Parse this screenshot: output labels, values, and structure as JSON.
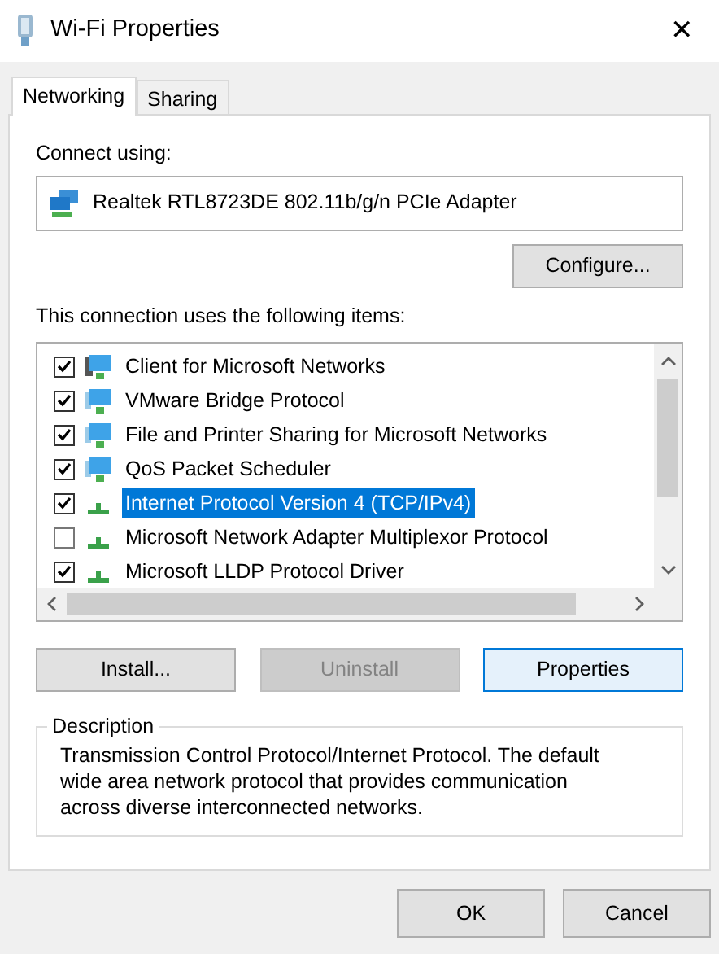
{
  "window": {
    "title": "Wi-Fi Properties",
    "close": "✕"
  },
  "tabs": [
    {
      "label": "Networking",
      "selected": true
    },
    {
      "label": "Sharing",
      "selected": false
    }
  ],
  "connect_using": {
    "label": "Connect using:",
    "adapter": "Realtek RTL8723DE 802.11b/g/n PCIe Adapter"
  },
  "configure_button": "Configure...",
  "items_label": "This connection uses the following items:",
  "items": [
    {
      "label": "Client for Microsoft Networks",
      "checked": true,
      "selected": false,
      "kind": "client"
    },
    {
      "label": "VMware Bridge Protocol",
      "checked": true,
      "selected": false,
      "kind": "service"
    },
    {
      "label": "File and Printer Sharing for Microsoft Networks",
      "checked": true,
      "selected": false,
      "kind": "service"
    },
    {
      "label": "QoS Packet Scheduler",
      "checked": true,
      "selected": false,
      "kind": "service"
    },
    {
      "label": "Internet Protocol Version 4 (TCP/IPv4)",
      "checked": true,
      "selected": true,
      "kind": "protocol"
    },
    {
      "label": "Microsoft Network Adapter Multiplexor Protocol",
      "checked": false,
      "selected": false,
      "kind": "protocol"
    },
    {
      "label": "Microsoft LLDP Protocol Driver",
      "checked": true,
      "selected": false,
      "kind": "protocol"
    }
  ],
  "item_buttons": [
    {
      "label": "Install...",
      "disabled": false,
      "focused": false
    },
    {
      "label": "Uninstall",
      "disabled": true,
      "focused": false
    },
    {
      "label": "Properties",
      "disabled": false,
      "focused": true
    }
  ],
  "description": {
    "title": "Description",
    "text": "Transmission Control Protocol/Internet Protocol. The default wide area network protocol that provides communication across diverse interconnected networks."
  },
  "dialog_buttons": [
    "OK",
    "Cancel"
  ]
}
